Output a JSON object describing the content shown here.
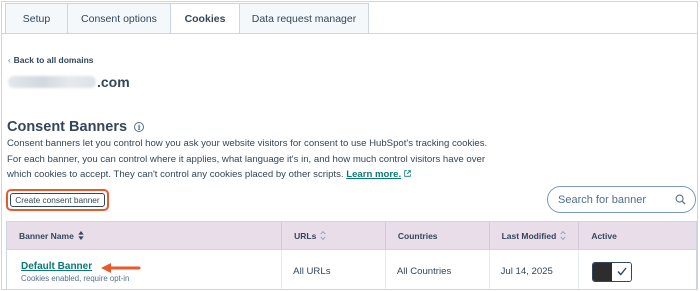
{
  "tabs": [
    {
      "label": "Setup",
      "active": false
    },
    {
      "label": "Consent options",
      "active": false
    },
    {
      "label": "Cookies",
      "active": true
    },
    {
      "label": "Data request manager",
      "active": false
    }
  ],
  "back_link": "Back to all domains",
  "domain_suffix": ".com",
  "section": {
    "title": "Consent Banners",
    "description": "Consent banners let you control how you ask your website visitors for consent to use HubSpot's tracking cookies. For each banner, you can control where it applies, what language it's in, and how much control visitors have over which cookies to accept. They can't control any cookies placed by other scripts.",
    "learn_more": "Learn more."
  },
  "create_button": "Create consent banner",
  "search": {
    "placeholder": "Search for banner",
    "value": ""
  },
  "table": {
    "headers": [
      "Banner Name",
      "URLs",
      "Countries",
      "Last Modified",
      "Active"
    ],
    "rows": [
      {
        "name": "Default Banner",
        "subtitle": "Cookies enabled, require opt-in",
        "urls": "All URLs",
        "countries": "All Countries",
        "last_modified": "Jul 14, 2025",
        "active": true
      }
    ]
  },
  "colors": {
    "accent": "#0b7a76",
    "highlight": "#e8592c",
    "header_bg": "#e8dde9",
    "text": "#33475b"
  }
}
